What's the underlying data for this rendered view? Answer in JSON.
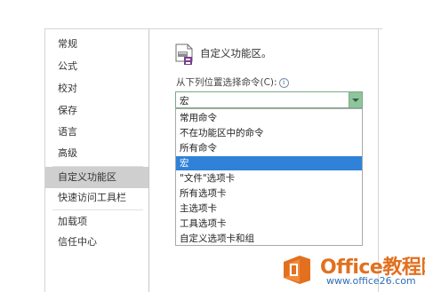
{
  "nav": {
    "items": [
      {
        "label": "常规"
      },
      {
        "label": "公式"
      },
      {
        "label": "校对"
      },
      {
        "label": "保存"
      },
      {
        "label": "语言"
      },
      {
        "label": "高级"
      },
      {
        "label": "自定义功能区"
      },
      {
        "label": "快速访问工具栏"
      },
      {
        "label": "加载项"
      },
      {
        "label": "信任中心"
      }
    ],
    "selected": "自定义功能区"
  },
  "header": {
    "title": "自定义功能区。",
    "icon": "customize-ribbon-icon"
  },
  "choose_commands": {
    "label": "从下列位置选择命令(C):",
    "info_icon": "i",
    "value": "宏",
    "options": [
      "常用命令",
      "不在功能区中的命令",
      "所有命令",
      "宏",
      "\"文件\"选项卡",
      "所有选项卡",
      "主选项卡",
      "工具选项卡",
      "自定义选项卡和组"
    ],
    "selected_option": "宏"
  },
  "watermark": {
    "name": "Office教程网",
    "url": "www.office26.com",
    "accent_color": "#e2701f",
    "url_color": "#2f6eb5"
  },
  "colors": {
    "selection_blue": "#2f82d8",
    "combo_green": "#8ec59d",
    "nav_selected": "#cfcfcf"
  }
}
